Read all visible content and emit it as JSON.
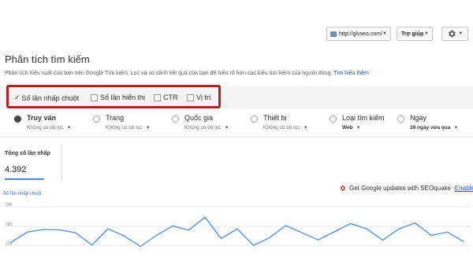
{
  "header": {
    "site_select": "http://glvseo.com/",
    "help_button": "Trợ giúp",
    "settings_icon": "gear-icon"
  },
  "page": {
    "title": "Phân tích tìm kiếm",
    "description": "Phân tích hiệu suất của bạn trên Google Tìm kiếm. Lọc và so sánh kết quả của bạn để hiểu rõ hơn các kiểu tìm kiếm của người dùng.",
    "learn_more": "Tìm hiểu thêm"
  },
  "metrics": [
    {
      "label": "Số lần nhấp chuột",
      "checked": true
    },
    {
      "label": "Số lần hiển thị",
      "checked": false
    },
    {
      "label": "CTR",
      "checked": false
    },
    {
      "label": "Vị trí",
      "checked": false
    }
  ],
  "dimensions": [
    {
      "label": "Truy vấn",
      "filter": "Không có bộ lọc",
      "selected": true
    },
    {
      "label": "Trang",
      "filter": "Không có bộ lọc",
      "selected": false
    },
    {
      "label": "Quốc gia",
      "filter": "Không có bộ lọc",
      "selected": false
    },
    {
      "label": "Thiết bị",
      "filter": "Không có bộ lọc",
      "selected": false
    },
    {
      "label": "Loại tìm kiếm",
      "filter": "Web",
      "selected": false
    },
    {
      "label": "Ngày",
      "filter": "28 ngày vừa qua",
      "selected": false
    }
  ],
  "summary": {
    "label": "Tổng số lần nhấp",
    "value": "4.392"
  },
  "seoquake": {
    "text": "Get Google updates with SEOquake - ",
    "link": "Enable"
  },
  "chart_data": {
    "type": "line",
    "series": [
      {
        "name": "Số lần nhấp chuột",
        "values": [
          130,
          162,
          170,
          169,
          160,
          122,
          172,
          150,
          118,
          152,
          181,
          168,
          208,
          142,
          172,
          121,
          145,
          182,
          160,
          138,
          163,
          188,
          172,
          137,
          172,
          190,
          152,
          162,
          133
        ]
      }
    ],
    "yticks": [
      "240",
      "180",
      "120"
    ],
    "ylim": [
      100,
      250
    ],
    "color": "#4a90e2"
  }
}
